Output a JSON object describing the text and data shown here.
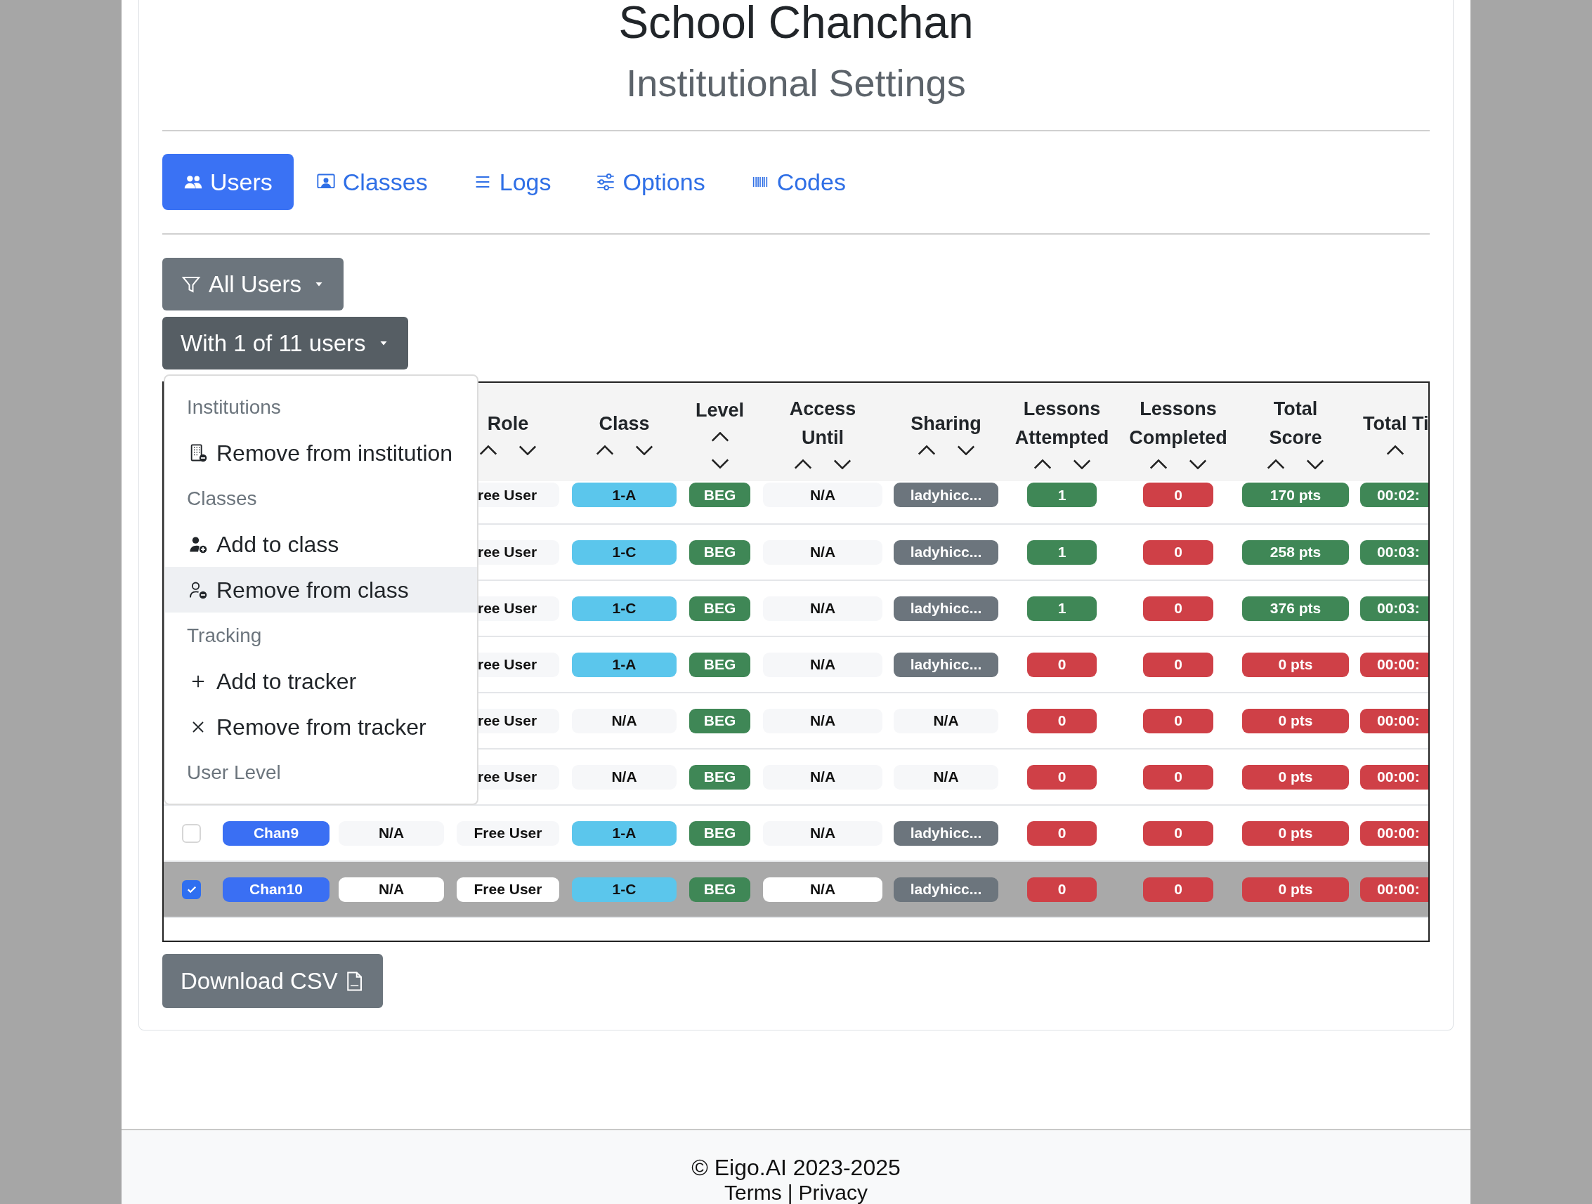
{
  "header": {
    "title": "School Chanchan",
    "subtitle": "Institutional Settings"
  },
  "tabs": [
    {
      "label": "Users",
      "selected": true
    },
    {
      "label": "Classes",
      "selected": false
    },
    {
      "label": "Logs",
      "selected": false
    },
    {
      "label": "Options",
      "selected": false
    },
    {
      "label": "Codes",
      "selected": false
    }
  ],
  "filters": [
    {
      "label": "All Users",
      "expanded": false
    },
    {
      "label": "With 1 of 11 users",
      "expanded": true
    }
  ],
  "menu": {
    "items": [
      {
        "kind": "header",
        "label": "Institutions"
      },
      {
        "kind": "action",
        "label": "Remove from institution",
        "selected": false
      },
      {
        "kind": "header",
        "label": "Classes"
      },
      {
        "kind": "action",
        "label": "Add to class",
        "selected": false
      },
      {
        "kind": "action",
        "label": "Remove from class",
        "selected": true
      },
      {
        "kind": "header",
        "label": "Tracking"
      },
      {
        "kind": "action",
        "label": "Add to tracker",
        "selected": false
      },
      {
        "kind": "action",
        "label": "Remove from tracker",
        "selected": false
      },
      {
        "kind": "header",
        "label": "User Level"
      }
    ]
  },
  "table": {
    "columns": [
      {
        "label": "Role"
      },
      {
        "label": "Class"
      },
      {
        "label": "Level"
      },
      {
        "label": "Access Until"
      },
      {
        "label": "Sharing"
      },
      {
        "label": "Lessons Attempted"
      },
      {
        "label": "Lessons Completed"
      },
      {
        "label": "Total Score"
      },
      {
        "label": "Total Ti"
      }
    ],
    "rows": [
      {
        "selected": false,
        "covered": true,
        "cells": [
          {
            "text": "ree User",
            "color": "#f6f7f9"
          },
          {
            "text": "1-A",
            "color": "#5bc6ec"
          },
          {
            "text": "BEG",
            "color": "#3f8756"
          },
          {
            "text": "N/A",
            "color": "#f6f7f9"
          },
          {
            "text": "ladyhicc...",
            "color": "#6c757d"
          },
          {
            "text": "1",
            "color": "#3f8756"
          },
          {
            "text": "0",
            "color": "#cf4047"
          },
          {
            "text": "170 pts",
            "color": "#3f8756"
          },
          {
            "text": "00:02:",
            "color": "#3f8756"
          }
        ]
      },
      {
        "selected": false,
        "covered": true,
        "cells": [
          {
            "text": "ree User",
            "color": "#f6f7f9"
          },
          {
            "text": "1-C",
            "color": "#5bc6ec"
          },
          {
            "text": "BEG",
            "color": "#3f8756"
          },
          {
            "text": "N/A",
            "color": "#f6f7f9"
          },
          {
            "text": "ladyhicc...",
            "color": "#6c757d"
          },
          {
            "text": "1",
            "color": "#3f8756"
          },
          {
            "text": "0",
            "color": "#cf4047"
          },
          {
            "text": "258 pts",
            "color": "#3f8756"
          },
          {
            "text": "00:03:",
            "color": "#3f8756"
          }
        ]
      },
      {
        "selected": false,
        "covered": true,
        "cells": [
          {
            "text": "ree User",
            "color": "#f6f7f9"
          },
          {
            "text": "1-C",
            "color": "#5bc6ec"
          },
          {
            "text": "BEG",
            "color": "#3f8756"
          },
          {
            "text": "N/A",
            "color": "#f6f7f9"
          },
          {
            "text": "ladyhicc...",
            "color": "#6c757d"
          },
          {
            "text": "1",
            "color": "#3f8756"
          },
          {
            "text": "0",
            "color": "#cf4047"
          },
          {
            "text": "376 pts",
            "color": "#3f8756"
          },
          {
            "text": "00:03:",
            "color": "#3f8756"
          }
        ]
      },
      {
        "selected": false,
        "covered": true,
        "cells": [
          {
            "text": "ree User",
            "color": "#f6f7f9"
          },
          {
            "text": "1-A",
            "color": "#5bc6ec"
          },
          {
            "text": "BEG",
            "color": "#3f8756"
          },
          {
            "text": "N/A",
            "color": "#f6f7f9"
          },
          {
            "text": "ladyhicc...",
            "color": "#6c757d"
          },
          {
            "text": "0",
            "color": "#cf4047"
          },
          {
            "text": "0",
            "color": "#cf4047"
          },
          {
            "text": "0 pts",
            "color": "#cf4047"
          },
          {
            "text": "00:00:",
            "color": "#cf4047"
          }
        ]
      },
      {
        "selected": false,
        "covered": true,
        "cells": [
          {
            "text": "ree User",
            "color": "#f6f7f9"
          },
          {
            "text": "N/A",
            "color": "#f6f7f9"
          },
          {
            "text": "BEG",
            "color": "#3f8756"
          },
          {
            "text": "N/A",
            "color": "#f6f7f9"
          },
          {
            "text": "N/A",
            "color": "#f6f7f9"
          },
          {
            "text": "0",
            "color": "#cf4047"
          },
          {
            "text": "0",
            "color": "#cf4047"
          },
          {
            "text": "0 pts",
            "color": "#cf4047"
          },
          {
            "text": "00:00:",
            "color": "#cf4047"
          }
        ]
      },
      {
        "selected": false,
        "covered": true,
        "cells": [
          {
            "text": "ree User",
            "color": "#f6f7f9"
          },
          {
            "text": "N/A",
            "color": "#f6f7f9"
          },
          {
            "text": "BEG",
            "color": "#3f8756"
          },
          {
            "text": "N/A",
            "color": "#f6f7f9"
          },
          {
            "text": "N/A",
            "color": "#f6f7f9"
          },
          {
            "text": "0",
            "color": "#cf4047"
          },
          {
            "text": "0",
            "color": "#cf4047"
          },
          {
            "text": "0 pts",
            "color": "#cf4047"
          },
          {
            "text": "00:00:",
            "color": "#cf4047"
          }
        ]
      },
      {
        "selected": false,
        "covered": false,
        "cells": [
          {
            "text": "Chan9",
            "color": "#3a6ff3"
          },
          {
            "text": "N/A",
            "color": "#f6f7f9"
          },
          {
            "text": "Free User",
            "color": "#f6f7f9"
          },
          {
            "text": "1-A",
            "color": "#5bc6ec"
          },
          {
            "text": "BEG",
            "color": "#3f8756"
          },
          {
            "text": "N/A",
            "color": "#f6f7f9"
          },
          {
            "text": "ladyhicc...",
            "color": "#6c757d"
          },
          {
            "text": "0",
            "color": "#cf4047"
          },
          {
            "text": "0",
            "color": "#cf4047"
          },
          {
            "text": "0 pts",
            "color": "#cf4047"
          },
          {
            "text": "00:00:",
            "color": "#cf4047"
          }
        ]
      },
      {
        "selected": true,
        "covered": false,
        "cells": [
          {
            "text": "Chan10",
            "color": "#3a6ff3"
          },
          {
            "text": "N/A",
            "color": "#ffffff"
          },
          {
            "text": "Free User",
            "color": "#ffffff"
          },
          {
            "text": "1-C",
            "color": "#5bc6ec"
          },
          {
            "text": "BEG",
            "color": "#3f8756"
          },
          {
            "text": "N/A",
            "color": "#ffffff"
          },
          {
            "text": "ladyhicc...",
            "color": "#6c757d"
          },
          {
            "text": "0",
            "color": "#cf4047"
          },
          {
            "text": "0",
            "color": "#cf4047"
          },
          {
            "text": "0 pts",
            "color": "#cf4047"
          },
          {
            "text": "00:00:",
            "color": "#cf4047"
          }
        ]
      }
    ]
  },
  "download_button": {
    "label": "Download CSV"
  },
  "footer": {
    "copyright": "© Eigo.AI 2023-2025",
    "links": [
      "Terms",
      "Privacy"
    ],
    "separator": "|"
  }
}
